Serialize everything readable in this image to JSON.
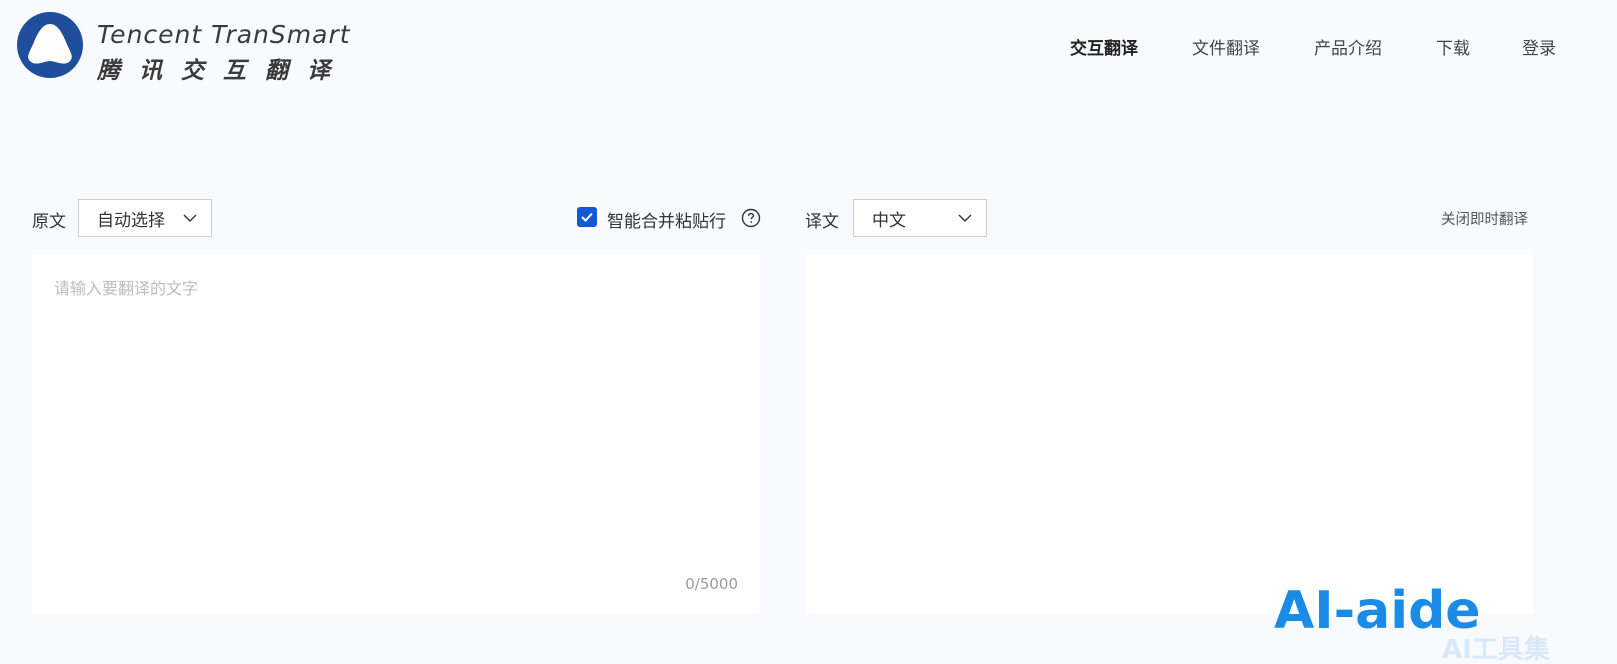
{
  "logo": {
    "en": "Tencent TranSmart",
    "cn": "腾讯交互翻译",
    "icon": "tencent-transmart-logo"
  },
  "nav": {
    "items": [
      {
        "label": "交互翻译",
        "active": true
      },
      {
        "label": "文件翻译",
        "active": false
      },
      {
        "label": "产品介绍",
        "active": false
      },
      {
        "label": "下载",
        "active": false
      },
      {
        "label": "登录",
        "active": false
      }
    ]
  },
  "source": {
    "label": "原文",
    "language": "自动选择",
    "placeholder": "请输入要翻译的文字",
    "counter": "0/5000"
  },
  "smart_merge": {
    "label": "智能合并粘贴行",
    "checked": true,
    "help_icon": "question-circle-icon"
  },
  "target": {
    "label": "译文",
    "language": "中文",
    "toggle_instant": "关闭即时翻译"
  },
  "watermark": {
    "text": "AI-aide",
    "suffix": "AI工具集"
  },
  "colors": {
    "accent": "#1558d6",
    "logo_blue": "#1f4e9c",
    "watermark_blue": "#1b8be8"
  }
}
